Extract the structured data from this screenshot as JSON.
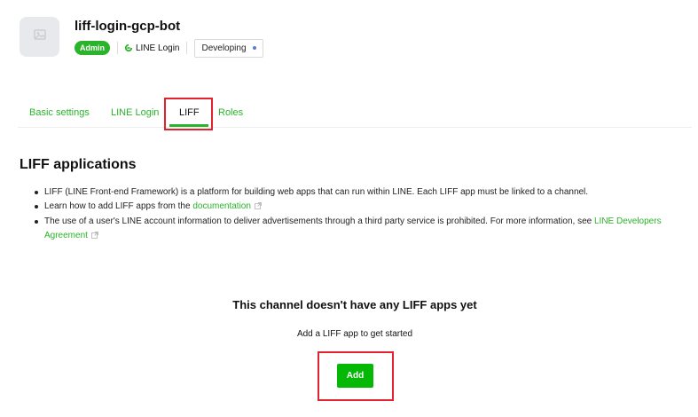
{
  "channel": {
    "name": "liff-login-gcp-bot",
    "role_badge": "Admin",
    "product": "LINE Login",
    "status": "Developing"
  },
  "tabs": [
    {
      "label": "Basic settings",
      "active": false
    },
    {
      "label": "LINE Login",
      "active": false
    },
    {
      "label": "LIFF",
      "active": true
    },
    {
      "label": "Roles",
      "active": false
    }
  ],
  "section": {
    "title": "LIFF applications",
    "bullet1": "LIFF (LINE Front-end Framework) is a platform for building web apps that can run within LINE. Each LIFF app must be linked to a channel.",
    "bullet2_prefix": "Learn how to add LIFF apps from the ",
    "bullet2_link": "documentation",
    "bullet3_prefix": "The use of a user's LINE account information to deliver advertisements through a third party service is prohibited. For more information, see ",
    "bullet3_link": "LINE Developers Agreement"
  },
  "empty_state": {
    "title": "This channel doesn't have any LIFF apps yet",
    "subtitle": "Add a LIFF app to get started",
    "button_label": "Add"
  },
  "colors": {
    "accent_green": "#2bb32b",
    "button_green": "#06b806",
    "highlight_red": "#e0232e",
    "status_dot": "#5a7cd6"
  }
}
